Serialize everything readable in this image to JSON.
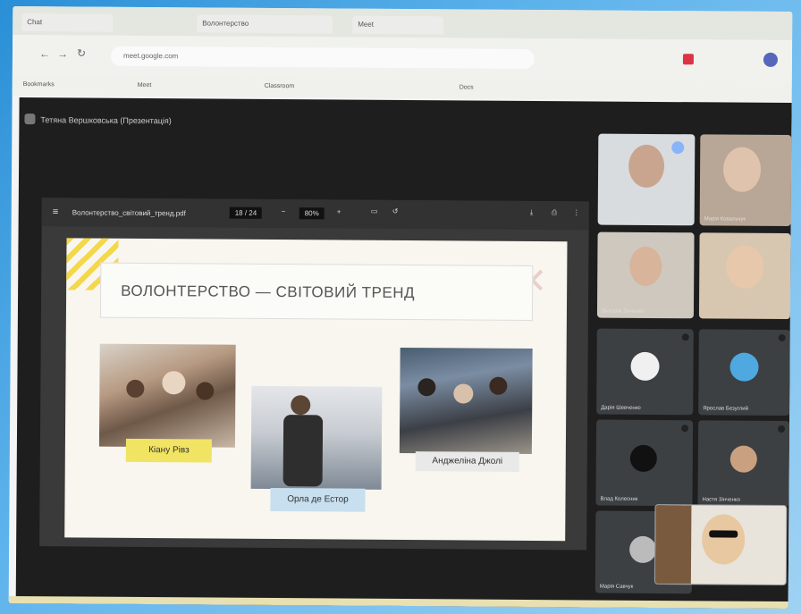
{
  "browser": {
    "tabs": [
      "Chat",
      "Волонтерство",
      "Meet"
    ],
    "url": "meet.google.com",
    "bookmarks": [
      "Bookmarks",
      "Meet",
      "Classroom",
      "Docs"
    ]
  },
  "meet": {
    "title": "Тетяна Вершковська (Презентація)"
  },
  "pdf": {
    "file_name": "Волонтерство_світовий_тренд.pdf",
    "page": "18 / 24",
    "zoom": "80%"
  },
  "slide": {
    "title": "ВОЛОНТЕРСТВО — СВІТОВИЙ ТРЕНД",
    "captions": [
      "Кіану Рівз",
      "Орла де Естор",
      "Анджеліна Джолі"
    ]
  },
  "participants": [
    {
      "name": ""
    },
    {
      "name": "Марія Ковальчук"
    },
    {
      "name": "Вікторія Зінченко"
    },
    {
      "name": ""
    },
    {
      "name": "Дарія Шевченко"
    },
    {
      "name": "Ярослав Безуглий"
    },
    {
      "name": "Влад Колесник"
    },
    {
      "name": "Настя Зінченко"
    },
    {
      "name": "Марія Савчук"
    }
  ]
}
